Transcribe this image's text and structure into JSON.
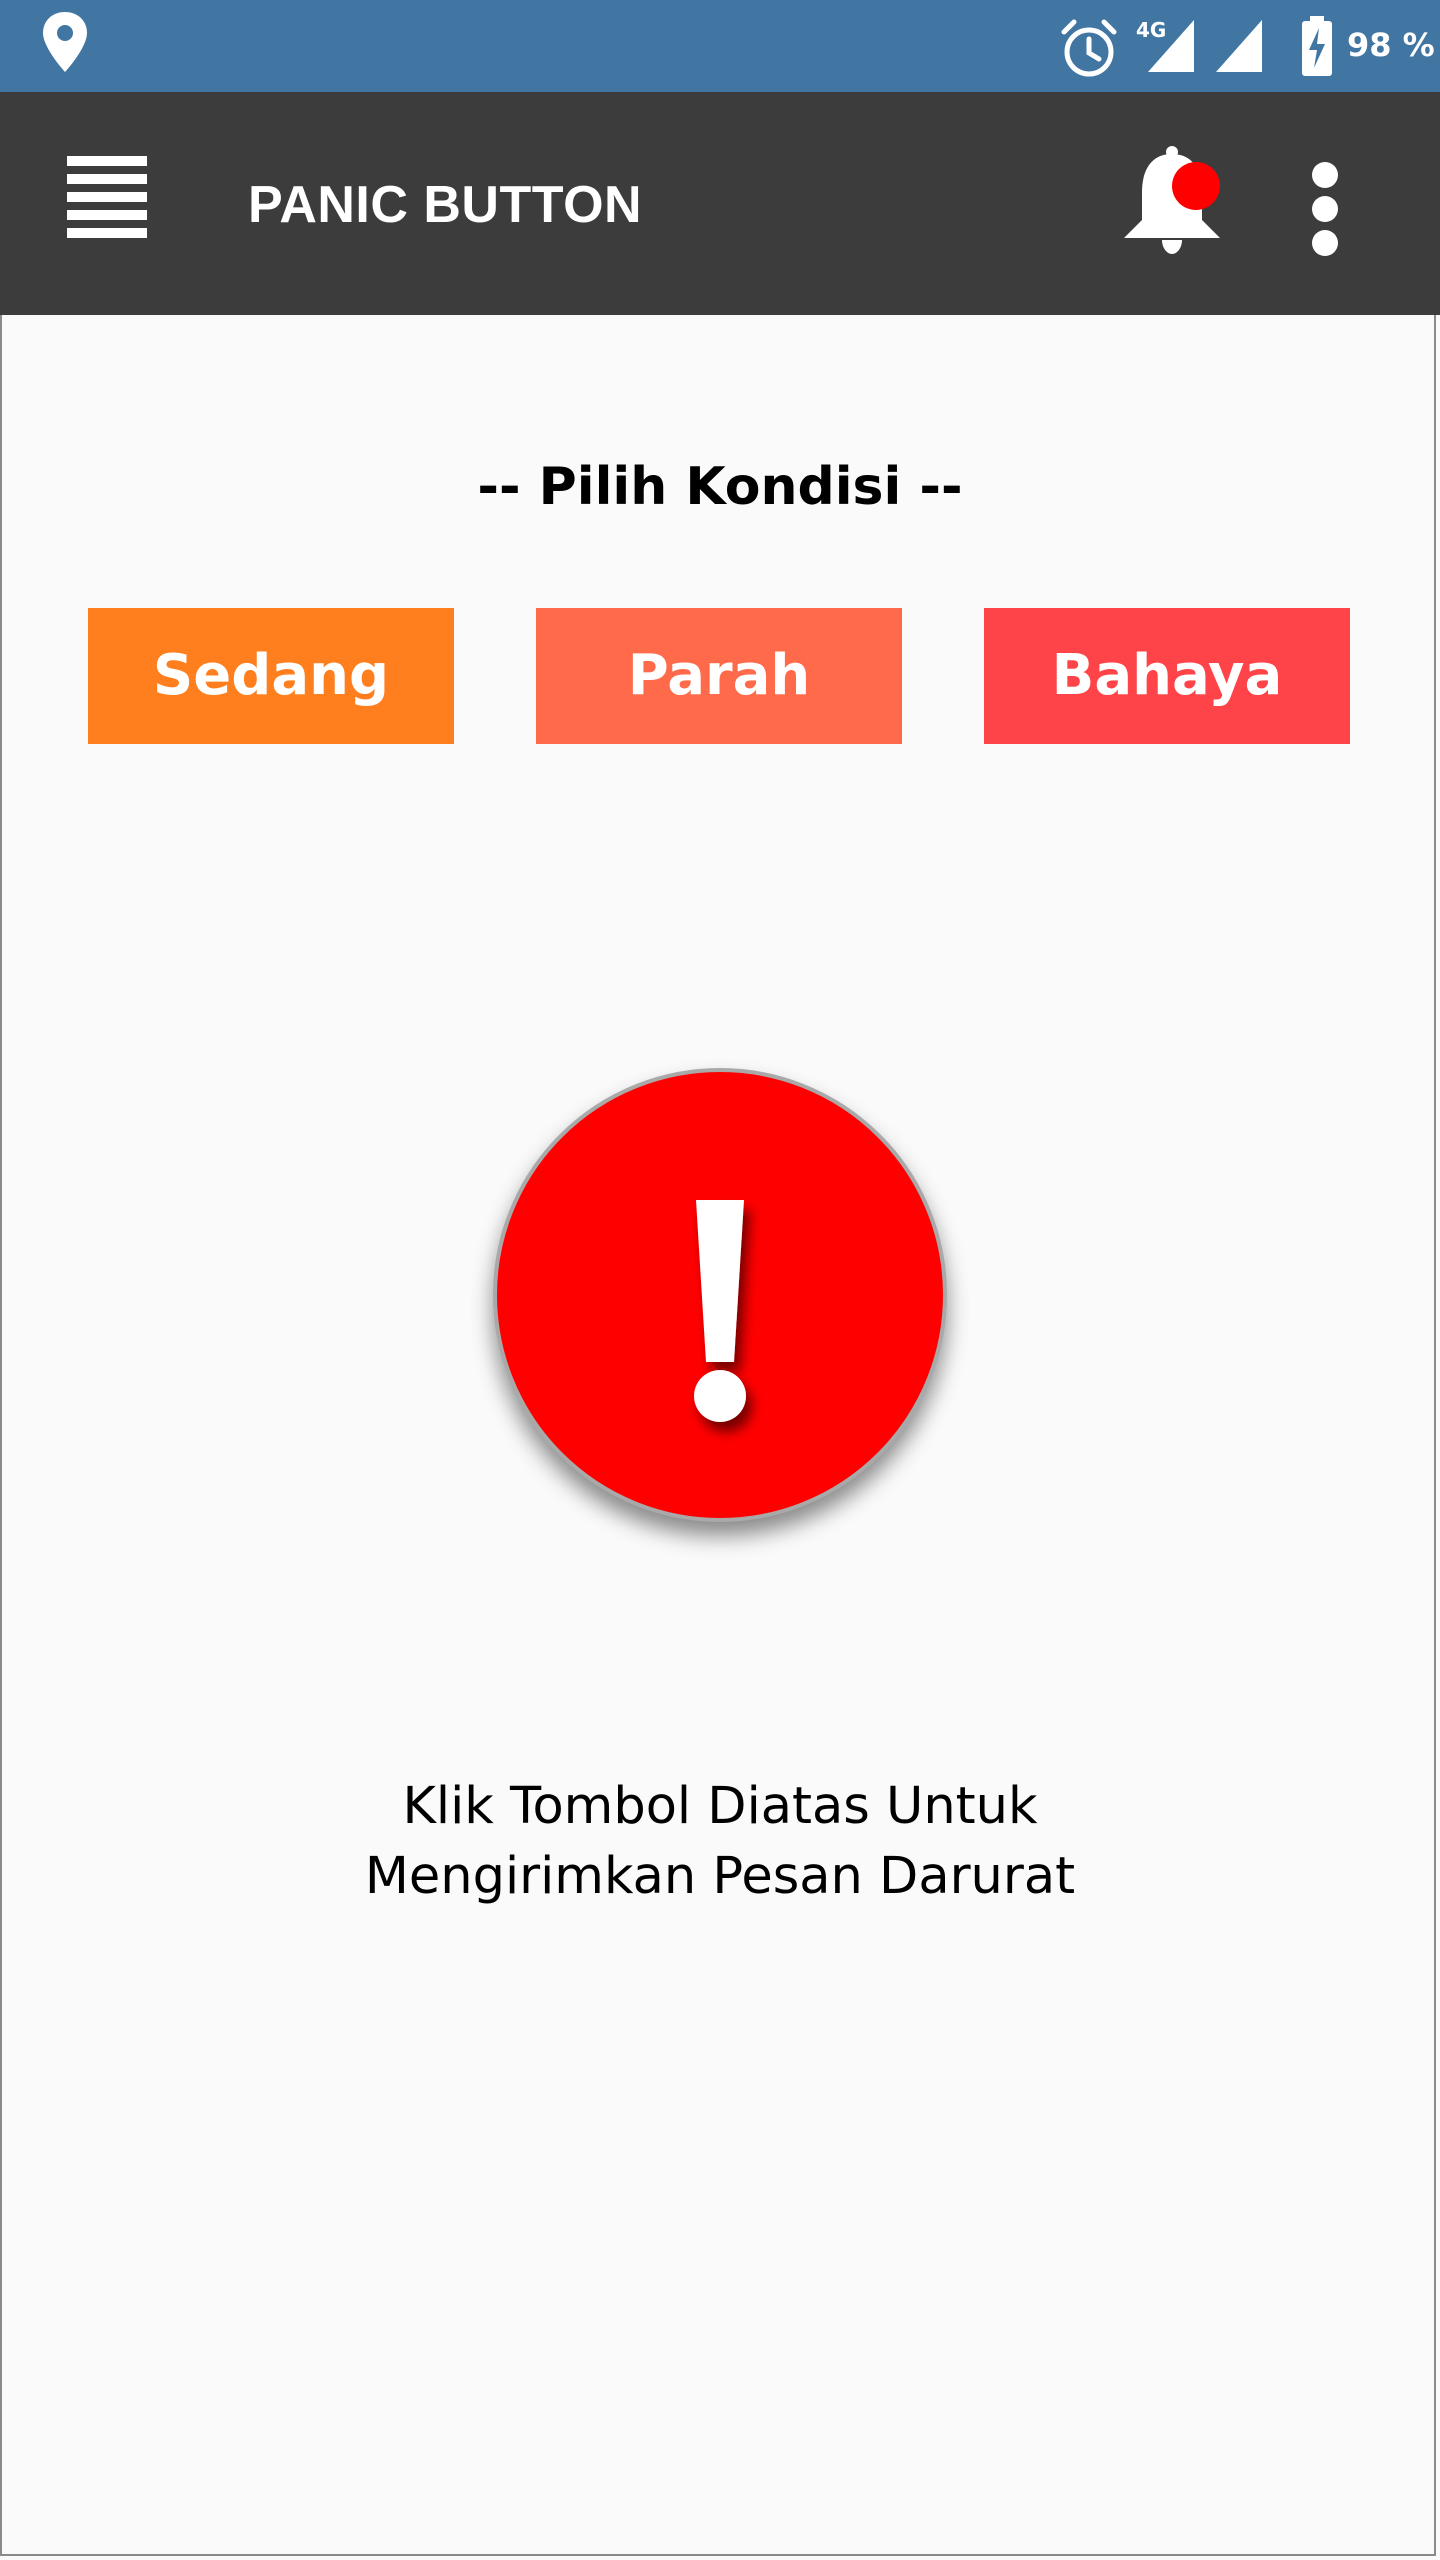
{
  "status_bar": {
    "location_icon": "map-pin-icon",
    "alarm_icon": "alarm-clock-icon",
    "network_label": "4G",
    "signal_icon": "cell-signal-icon",
    "battery_icon": "battery-charging-icon",
    "battery_text": "98 %"
  },
  "app_bar": {
    "menu_icon": "hamburger-menu-icon",
    "title": "PANIC BUTTON",
    "notification_icon": "bell-icon",
    "overflow_icon": "more-vertical-icon"
  },
  "main": {
    "section_title": "-- Pilih Kondisi --",
    "conditions": [
      {
        "label": "Sedang",
        "color": "#ff7f1e"
      },
      {
        "label": "Parah",
        "color": "#ff6a4a"
      },
      {
        "label": "Bahaya",
        "color": "#ff4449"
      }
    ],
    "panic_icon": "exclamation-icon",
    "panic_color": "#ff0000",
    "instruction_line1": "Klik Tombol Diatas Untuk",
    "instruction_line2": "Mengirimkan Pesan Darurat"
  },
  "colors": {
    "status_bar": "#4176a3",
    "app_bar": "#3c3c3c",
    "background": "#fafafa",
    "notification_dot": "#ff0000"
  }
}
